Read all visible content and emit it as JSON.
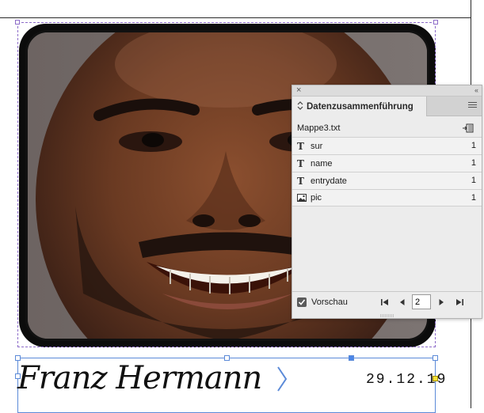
{
  "colors": {
    "selection_purple": "#8d6cc9",
    "selection_blue": "#5b8ad8",
    "overset_yellow": "#f6e23a",
    "panel_bg": "#ececec"
  },
  "document": {
    "name_text": "Franz Hermann",
    "date_text": "29.12.19"
  },
  "panel": {
    "close_glyph": "×",
    "collapse_glyph": "‹‹",
    "tab_label": "Datenzusammenführung",
    "source_file": "Mappe3.txt",
    "fields": [
      {
        "type": "text",
        "type_glyph": "T",
        "name": "sur",
        "count": "1"
      },
      {
        "type": "text",
        "type_glyph": "T",
        "name": "name",
        "count": "1"
      },
      {
        "type": "text",
        "type_glyph": "T",
        "name": "entrydate",
        "count": "1"
      },
      {
        "type": "image",
        "type_glyph": "",
        "name": "pic",
        "count": "1"
      }
    ],
    "preview_label": "Vorschau",
    "preview_checked": true,
    "record_number": "2"
  },
  "icons": {
    "panel_menu": "panel-menu-icon",
    "source_action": "create-merged-document-icon",
    "first": "first-record-icon",
    "prev": "previous-record-icon",
    "next": "next-record-icon",
    "last": "last-record-icon"
  }
}
